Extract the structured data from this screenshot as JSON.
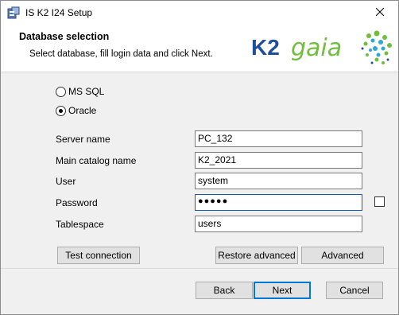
{
  "window": {
    "title": "IS K2 I24 Setup"
  },
  "header": {
    "title": "Database selection",
    "subtitle": "Select database, fill login data and click Next.",
    "logo_text": "K2 gaia"
  },
  "database_type": {
    "options": [
      {
        "label": "MS SQL",
        "selected": false
      },
      {
        "label": "Oracle",
        "selected": true
      }
    ]
  },
  "fields": {
    "server_name": {
      "label": "Server name",
      "value": "PC_132"
    },
    "catalog": {
      "label": "Main catalog name",
      "value": "K2_2021"
    },
    "user": {
      "label": "User",
      "value": "system"
    },
    "password": {
      "label": "Password",
      "value": "●●●●●"
    },
    "tablespace": {
      "label": "Tablespace",
      "value": "users"
    }
  },
  "buttons": {
    "test_connection": "Test connection",
    "restore_advanced": "Restore advanced",
    "advanced": "Advanced",
    "back": "Back",
    "next": "Next",
    "cancel": "Cancel"
  },
  "colors": {
    "accent": "#0078d7",
    "logo_blue": "#1f4e9c",
    "logo_green": "#6fbf3a"
  }
}
